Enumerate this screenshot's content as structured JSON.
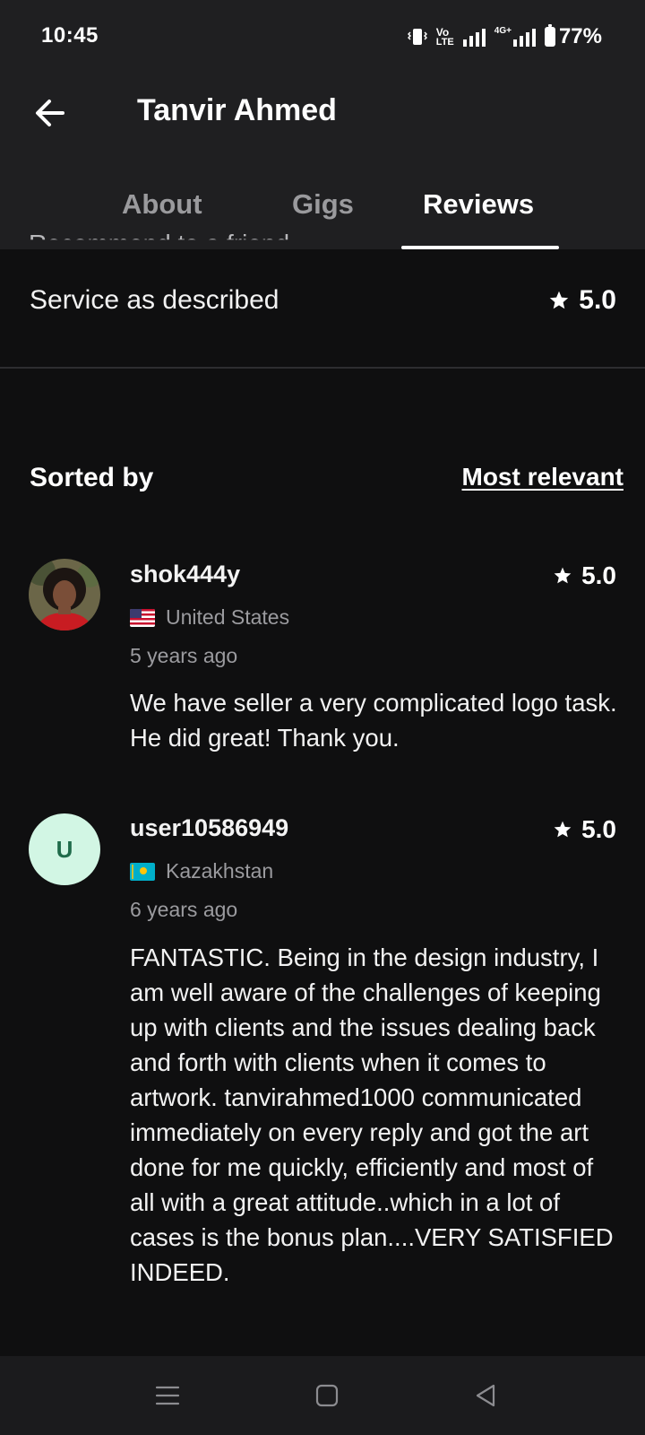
{
  "status_bar": {
    "time": "10:45",
    "volte_top": "Vo",
    "volte_bottom": "LTE",
    "network": "4G+",
    "battery": "77%"
  },
  "header": {
    "title": "Tanvir Ahmed"
  },
  "tabs": [
    {
      "label": "About",
      "active": false
    },
    {
      "label": "Gigs",
      "active": false
    },
    {
      "label": "Reviews",
      "active": true
    }
  ],
  "breakdown": {
    "peek_label": "Recommend to a friend",
    "service_label": "Service as described",
    "service_rating": "5.0"
  },
  "sort": {
    "label": "Sorted by",
    "value": "Most relevant"
  },
  "reviews": [
    {
      "username": "shok444y",
      "rating": "5.0",
      "country": "United States",
      "time_ago": "5 years ago",
      "text": "We have seller a very complicated logo task. He did great! Thank you."
    },
    {
      "avatar_initial": "U",
      "username": "user10586949",
      "rating": "5.0",
      "country": "Kazakhstan",
      "time_ago": "6 years ago",
      "text": "FANTASTIC. Being in the design industry, I am well aware of the challenges of keeping up with clients and the issues dealing back and forth with clients when it comes to artwork. tanvirahmed1000 communicated immediately on every reply and got the art done for me quickly, efficiently and most of all with a great attitude..which in a lot of cases is the bonus plan....VERY SATISFIED INDEED."
    }
  ],
  "colors": {
    "background": "#0f0f10",
    "header_bg": "#1f1f21",
    "avatar_initial_bg": "#d2f6e4",
    "avatar_initial_fg": "#1f6b4a"
  },
  "icons": {
    "back": "arrow-left-icon",
    "star": "star-icon",
    "nav_menu": "menu-icon",
    "nav_home": "square-icon",
    "nav_back": "triangle-back-icon"
  }
}
